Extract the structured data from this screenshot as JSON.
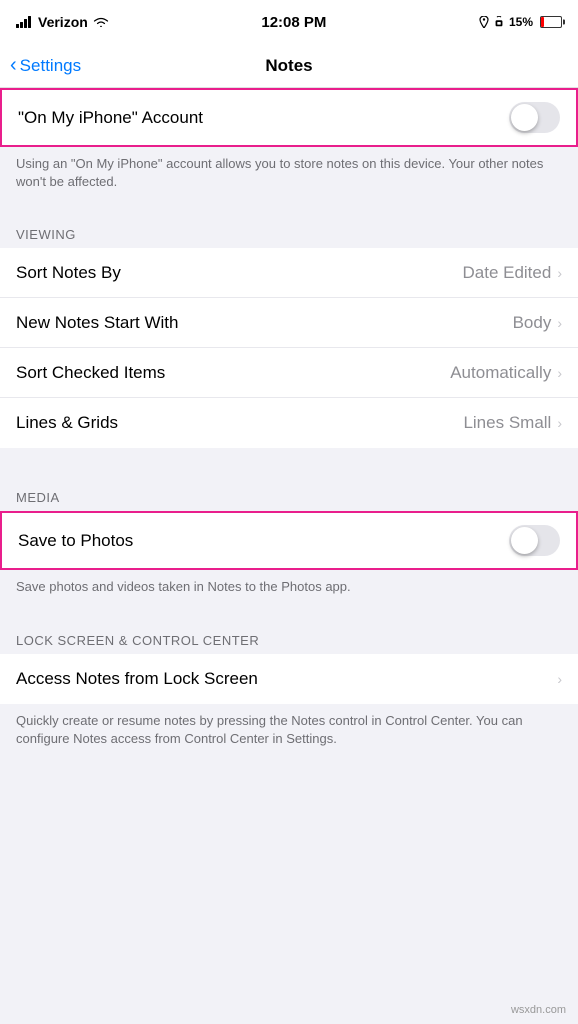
{
  "status_bar": {
    "carrier": "Verizon",
    "time": "12:08 PM",
    "battery_percent": "15%",
    "battery_level": 15
  },
  "nav": {
    "back_label": "Settings",
    "title": "Notes"
  },
  "sections": {
    "on_my_iphone": {
      "label": "\"On My iPhone\" Account",
      "toggle_on": false,
      "description": "Using an \"On My iPhone\" account allows you to store notes on this device. Your other notes won't be affected."
    },
    "viewing": {
      "header": "VIEWING",
      "rows": [
        {
          "label": "Sort Notes By",
          "value": "Date Edited"
        },
        {
          "label": "New Notes Start With",
          "value": "Body"
        },
        {
          "label": "Sort Checked Items",
          "value": "Automatically"
        },
        {
          "label": "Lines & Grids",
          "value": "Lines Small"
        }
      ]
    },
    "media": {
      "header": "MEDIA",
      "save_to_photos": {
        "label": "Save to Photos",
        "toggle_on": false,
        "description": "Save photos and videos taken in Notes to the Photos app."
      }
    },
    "lock_screen": {
      "header": "LOCK SCREEN & CONTROL CENTER",
      "rows": [
        {
          "label": "Access Notes from Lock Screen",
          "value": ""
        }
      ],
      "description": "Quickly create or resume notes by pressing the Notes control in Control Center. You can configure Notes access from Control Center in Settings."
    }
  },
  "watermark": "wsxdn.com"
}
